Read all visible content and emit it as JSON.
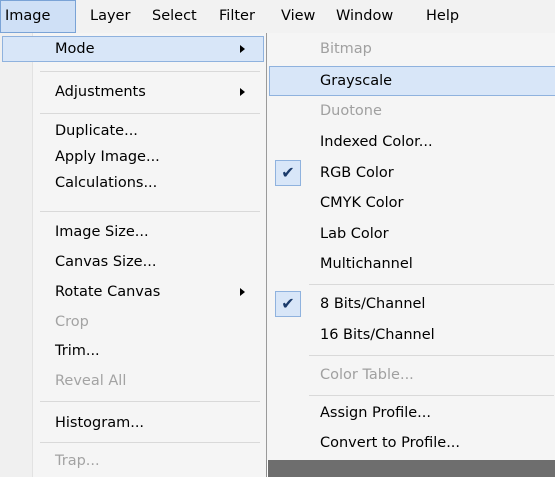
{
  "menubar": {
    "items": [
      "Image",
      "Layer",
      "Select",
      "Filter",
      "View",
      "Window",
      "Help"
    ]
  },
  "image_menu": {
    "items": [
      "Mode",
      "Adjustments",
      "Duplicate...",
      "Apply Image...",
      "Calculations...",
      "Image Size...",
      "Canvas Size...",
      "Rotate Canvas",
      "Crop",
      "Trim...",
      "Reveal All",
      "Histogram...",
      "Trap..."
    ]
  },
  "mode_menu": {
    "items": [
      "Bitmap",
      "Grayscale",
      "Duotone",
      "Indexed Color...",
      "RGB Color",
      "CMYK Color",
      "Lab Color",
      "Multichannel",
      "8 Bits/Channel",
      "16 Bits/Channel",
      "Color Table...",
      "Assign Profile...",
      "Convert to Profile..."
    ],
    "check_glyph": "✔"
  }
}
